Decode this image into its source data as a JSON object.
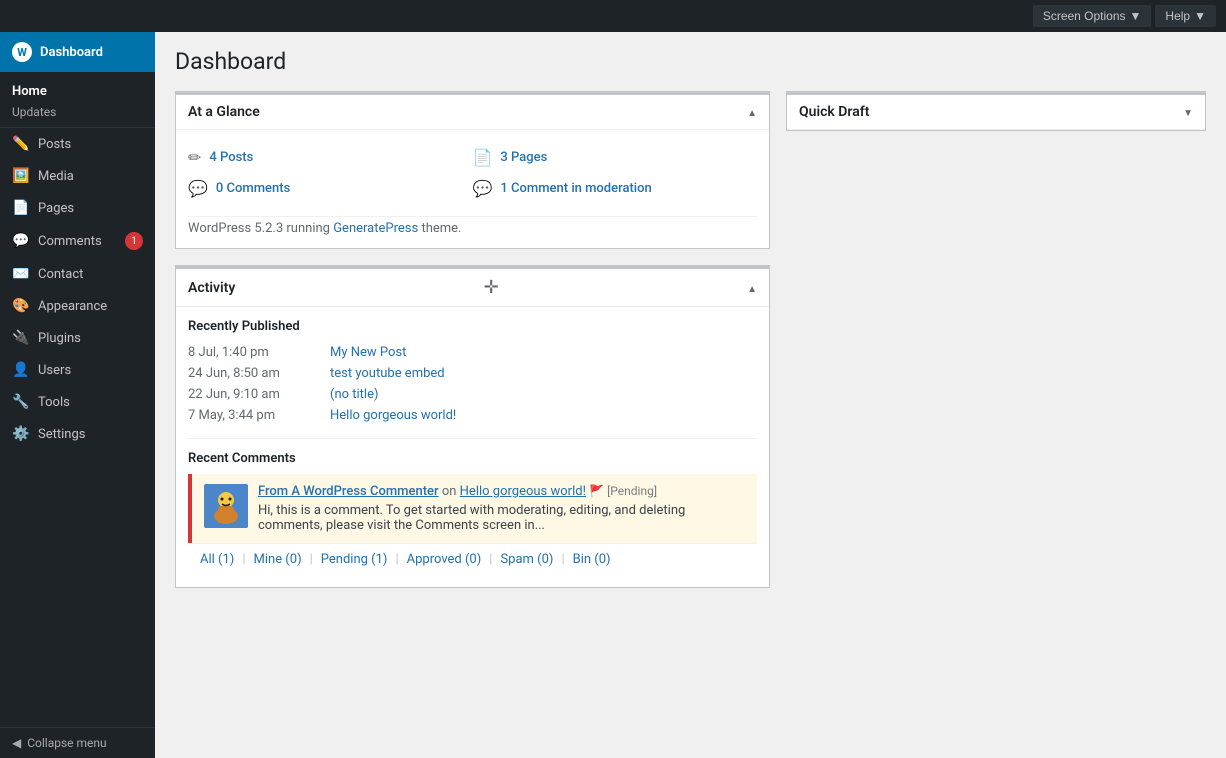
{
  "topbar": {
    "screen_options_label": "Screen Options",
    "help_label": "Help"
  },
  "sidebar": {
    "dashboard_label": "Dashboard",
    "wp_icon": "W",
    "home_label": "Home",
    "updates_label": "Updates",
    "menu_items": [
      {
        "id": "posts",
        "label": "Posts",
        "icon": "✏️",
        "badge": null
      },
      {
        "id": "media",
        "label": "Media",
        "icon": "🖼️",
        "badge": null
      },
      {
        "id": "pages",
        "label": "Pages",
        "icon": "📄",
        "badge": null
      },
      {
        "id": "comments",
        "label": "Comments",
        "icon": "💬",
        "badge": "1"
      },
      {
        "id": "contact",
        "label": "Contact",
        "icon": "✉️",
        "badge": null
      },
      {
        "id": "appearance",
        "label": "Appearance",
        "icon": "🎨",
        "badge": null
      },
      {
        "id": "plugins",
        "label": "Plugins",
        "icon": "🔌",
        "badge": null
      },
      {
        "id": "users",
        "label": "Users",
        "icon": "👤",
        "badge": null
      },
      {
        "id": "tools",
        "label": "Tools",
        "icon": "🔧",
        "badge": null
      },
      {
        "id": "settings",
        "label": "Settings",
        "icon": "⚙️",
        "badge": null
      }
    ],
    "collapse_label": "Collapse menu",
    "collapse_icon": "◀"
  },
  "page": {
    "title": "Dashboard"
  },
  "at_a_glance": {
    "title": "At a Glance",
    "posts_count": "4 Posts",
    "pages_count": "3 Pages",
    "comments_count": "0 Comments",
    "moderation_count": "1 Comment in moderation",
    "wp_version": "WordPress 5.2.3",
    "running_text": " running ",
    "theme_link": "GeneratePress",
    "theme_suffix": " theme."
  },
  "activity": {
    "title": "Activity",
    "recently_published_label": "Recently Published",
    "posts": [
      {
        "date": "8 Jul, 1:40 pm",
        "link": "My New Post"
      },
      {
        "date": "24 Jun, 8:50 am",
        "link": "test youtube embed"
      },
      {
        "date": "22 Jun, 9:10 am",
        "link": "(no title)"
      },
      {
        "date": "7 May, 3:44 pm",
        "link": "Hello gorgeous world!"
      }
    ],
    "recent_comments_label": "Recent Comments",
    "comment": {
      "author": "From A WordPress Commenter",
      "on_text": " on ",
      "post_link": "Hello gorgeous world!",
      "pending_flag": "🚩",
      "pending_text": "[Pending]",
      "body": "Hi, this is a comment. To get started with moderating, editing, and deleting comments, please visit the Comments screen in..."
    },
    "filters": [
      {
        "label": "All (1)",
        "id": "all"
      },
      {
        "label": "Mine (0)",
        "id": "mine"
      },
      {
        "label": "Pending (1)",
        "id": "pending"
      },
      {
        "label": "Approved (0)",
        "id": "approved"
      },
      {
        "label": "Spam (0)",
        "id": "spam"
      },
      {
        "label": "Bin (0)",
        "id": "bin"
      }
    ]
  },
  "quick_draft": {
    "title": "Quick Draft"
  }
}
